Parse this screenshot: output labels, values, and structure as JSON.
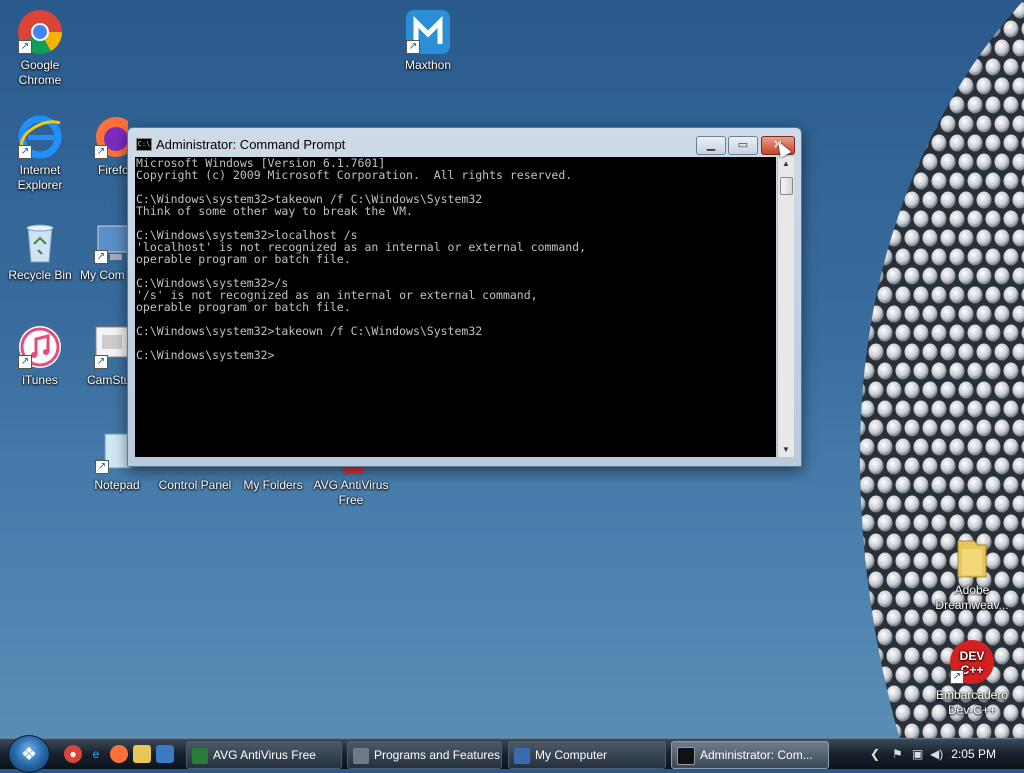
{
  "desktop": {
    "icons": [
      {
        "label": "Google Chrome",
        "icon": "chrome-icon"
      },
      {
        "label": "Maxthon",
        "icon": "maxthon-icon"
      },
      {
        "label": "Internet Explorer",
        "icon": "ie-icon"
      },
      {
        "label": "Firefo",
        "icon": "firefox-icon"
      },
      {
        "label": "Recycle Bin",
        "icon": "recycle-bin-icon"
      },
      {
        "label": "My Com",
        "icon": "computer-icon"
      },
      {
        "label": "iTunes",
        "icon": "itunes-icon"
      },
      {
        "label": "CamStu",
        "icon": "camstudio-icon"
      },
      {
        "label": "Notepad",
        "icon": "notepad-icon"
      },
      {
        "label": "Control Panel",
        "icon": "control-panel-icon"
      },
      {
        "label": "My Folders",
        "icon": "folders-icon"
      },
      {
        "label": "AVG AntiVirus Free",
        "icon": "avg-icon"
      },
      {
        "label": "Adobe Dreamweav...",
        "icon": "folder-icon"
      },
      {
        "label": "Embarcadero Dev-C++",
        "icon": "devcpp-icon"
      }
    ]
  },
  "window": {
    "title": "Administrator: Command Prompt",
    "console_lines": [
      "Microsoft Windows [Version 6.1.7601]",
      "Copyright (c) 2009 Microsoft Corporation.  All rights reserved.",
      "",
      "C:\\Windows\\system32>takeown /f C:\\Windows\\System32",
      "Think of some other way to break the VM.",
      "",
      "C:\\Windows\\system32>localhost /s",
      "'localhost' is not recognized as an internal or external command,",
      "operable program or batch file.",
      "",
      "C:\\Windows\\system32>/s",
      "'/s' is not recognized as an internal or external command,",
      "operable program or batch file.",
      "",
      "C:\\Windows\\system32>takeown /f C:\\Windows\\System32",
      "",
      "C:\\Windows\\system32>"
    ]
  },
  "taskbar": {
    "tasks": [
      {
        "label": "AVG AntiVirus Free",
        "color": "#2a7a3a"
      },
      {
        "label": "Programs and Features",
        "color": "#6b7b8b"
      },
      {
        "label": "My Computer",
        "color": "#3a6ab0"
      },
      {
        "label": "Administrator: Com...",
        "color": "#111111"
      }
    ],
    "clock": "2:05 PM"
  },
  "colors": {
    "console_bg": "#000000",
    "console_fg": "#c0c0c0",
    "desktop_bg": "#3a6e9e"
  }
}
